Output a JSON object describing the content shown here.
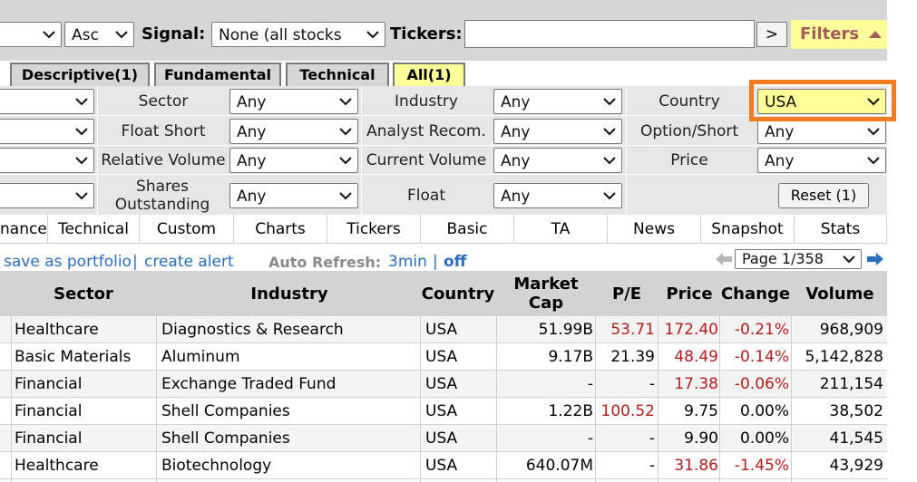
{
  "topbar": {
    "order_dir": "Asc",
    "signal_label": "Signal:",
    "signal_value": "None (all stocks",
    "tickers_label": "Tickers:",
    "tickers_value": "",
    "go_label": ">",
    "filters_label": "Filters",
    "filters_icon": "caret-up-icon"
  },
  "filter_tabs": [
    {
      "label": "Descriptive(1)",
      "active": false
    },
    {
      "label": "Fundamental",
      "active": false
    },
    {
      "label": "Technical",
      "active": false
    },
    {
      "label": "All(1)",
      "active": true
    }
  ],
  "filters": {
    "sector": {
      "label": "Sector",
      "value": "Any"
    },
    "industry": {
      "label": "Industry",
      "value": "Any"
    },
    "country": {
      "label": "Country",
      "value": "USA"
    },
    "float_short": {
      "label": "Float Short",
      "value": "Any"
    },
    "analyst_recom": {
      "label": "Analyst Recom.",
      "value": "Any"
    },
    "option_short": {
      "label": "Option/Short",
      "value": "Any"
    },
    "relative_volume": {
      "label": "Relative Volume",
      "value": "Any"
    },
    "current_volume": {
      "label": "Current Volume",
      "value": "Any"
    },
    "price": {
      "label": "Price",
      "value": "Any"
    },
    "shares_outstanding": {
      "label": "Shares Outstanding",
      "value": "Any"
    },
    "float": {
      "label": "Float",
      "value": "Any"
    },
    "reset_label": "Reset (1)"
  },
  "view_tabs": [
    "nance",
    "Technical",
    "Custom",
    "Charts",
    "Tickers",
    "Basic",
    "TA",
    "News",
    "Snapshot",
    "Stats"
  ],
  "actions": {
    "save_portfolio": "save as portfolio",
    "separator": "|",
    "create_alert": "create alert",
    "auto_refresh_label": "Auto Refresh:",
    "auto_refresh_value": "3min",
    "off_label": "off",
    "page_value": "Page 1/358"
  },
  "table": {
    "headers": {
      "sector": "Sector",
      "industry": "Industry",
      "country": "Country",
      "market_cap_1": "Market",
      "market_cap_2": "Cap",
      "pe": "P/E",
      "price": "Price",
      "change": "Change",
      "volume": "Volume"
    },
    "rows": [
      {
        "sector": "Healthcare",
        "industry": "Diagnostics & Research",
        "country": "USA",
        "market_cap": "51.99B",
        "pe": "53.71",
        "price": "172.40",
        "change": "-0.21%",
        "volume": "968,909"
      },
      {
        "sector": "Basic Materials",
        "industry": "Aluminum",
        "country": "USA",
        "market_cap": "9.17B",
        "pe": "21.39",
        "price": "48.49",
        "change": "-0.14%",
        "volume": "5,142,828"
      },
      {
        "sector": "Financial",
        "industry": "Exchange Traded Fund",
        "country": "USA",
        "market_cap": "-",
        "pe": "-",
        "price": "17.38",
        "change": "-0.06%",
        "volume": "211,154"
      },
      {
        "sector": "Financial",
        "industry": "Shell Companies",
        "country": "USA",
        "market_cap": "1.22B",
        "pe": "100.52",
        "price": "9.75",
        "change": "0.00%",
        "volume": "38,502"
      },
      {
        "sector": "Financial",
        "industry": "Shell Companies",
        "country": "USA",
        "market_cap": "-",
        "pe": "-",
        "price": "9.90",
        "change": "0.00%",
        "volume": "41,545"
      },
      {
        "sector": "Healthcare",
        "industry": "Biotechnology",
        "country": "USA",
        "market_cap": "640.07M",
        "pe": "-",
        "price": "31.86",
        "change": "-1.45%",
        "volume": "43,929"
      }
    ]
  },
  "colors": {
    "accent_highlight": "#f47c20",
    "filter_active": "#ffff99",
    "negative": "#b31b1b",
    "link": "#2a6ebb"
  }
}
